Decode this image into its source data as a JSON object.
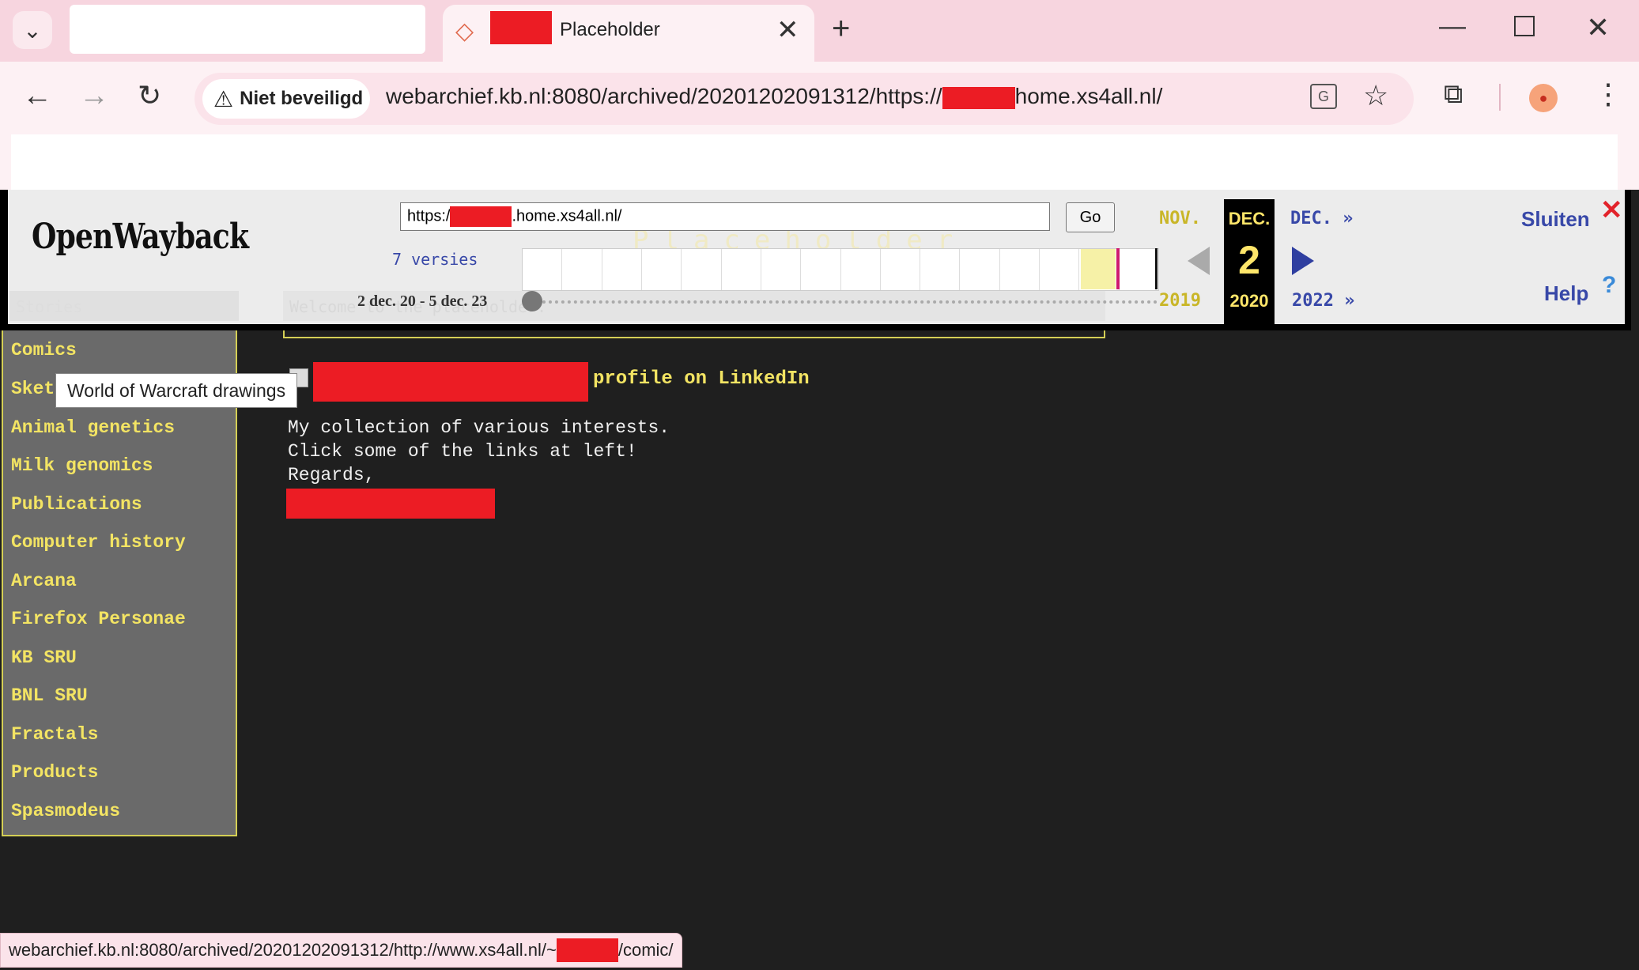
{
  "browser": {
    "tab_title": "Placeholder",
    "tab_close": "✕",
    "new_tab": "+",
    "security_label": "Niet beveiligd",
    "url_prefix": "webarchief.kb.nl:8080/archived/20201202091312/https://",
    "url_suffix": "home.xs4all.nl/"
  },
  "wayback": {
    "logo": "OpenWayback",
    "url_input_prefix": "https:/",
    "url_input_suffix": ".home.xs4all.nl/",
    "go_label": "Go",
    "versions": "7 versies",
    "date_range": "2 dec. 20 - 5 dec. 23",
    "prev_month": "NOV.",
    "current_month": "DEC.",
    "current_day": "2",
    "current_year": "2020",
    "next_month": "DEC. »",
    "prev_year": "2019",
    "next_year": "2022 »",
    "close_label": "Sluiten",
    "help_label": "Help"
  },
  "sidebar": {
    "items": [
      {
        "label": "Comics"
      },
      {
        "label": "Sket"
      },
      {
        "label": "Animal genetics"
      },
      {
        "label": "Milk genomics"
      },
      {
        "label": "Publications"
      },
      {
        "label": "Computer history"
      },
      {
        "label": "Arcana"
      },
      {
        "label": "Firefox Personae"
      },
      {
        "label": "KB SRU"
      },
      {
        "label": "BNL SRU"
      },
      {
        "label": "Fractals"
      },
      {
        "label": "Products"
      },
      {
        "label": "Spasmodeus"
      }
    ]
  },
  "tooltip": "World of Warcraft drawings",
  "main": {
    "linkedin_text": "profile on LinkedIn",
    "lines": [
      "My collection of various interests.",
      "Click some of the links at left!",
      "Regards,"
    ]
  },
  "status": {
    "prefix": "webarchief.kb.nl:8080/archived/20201202091312/http://www.xs4all.nl/~",
    "suffix": "/comic/"
  }
}
